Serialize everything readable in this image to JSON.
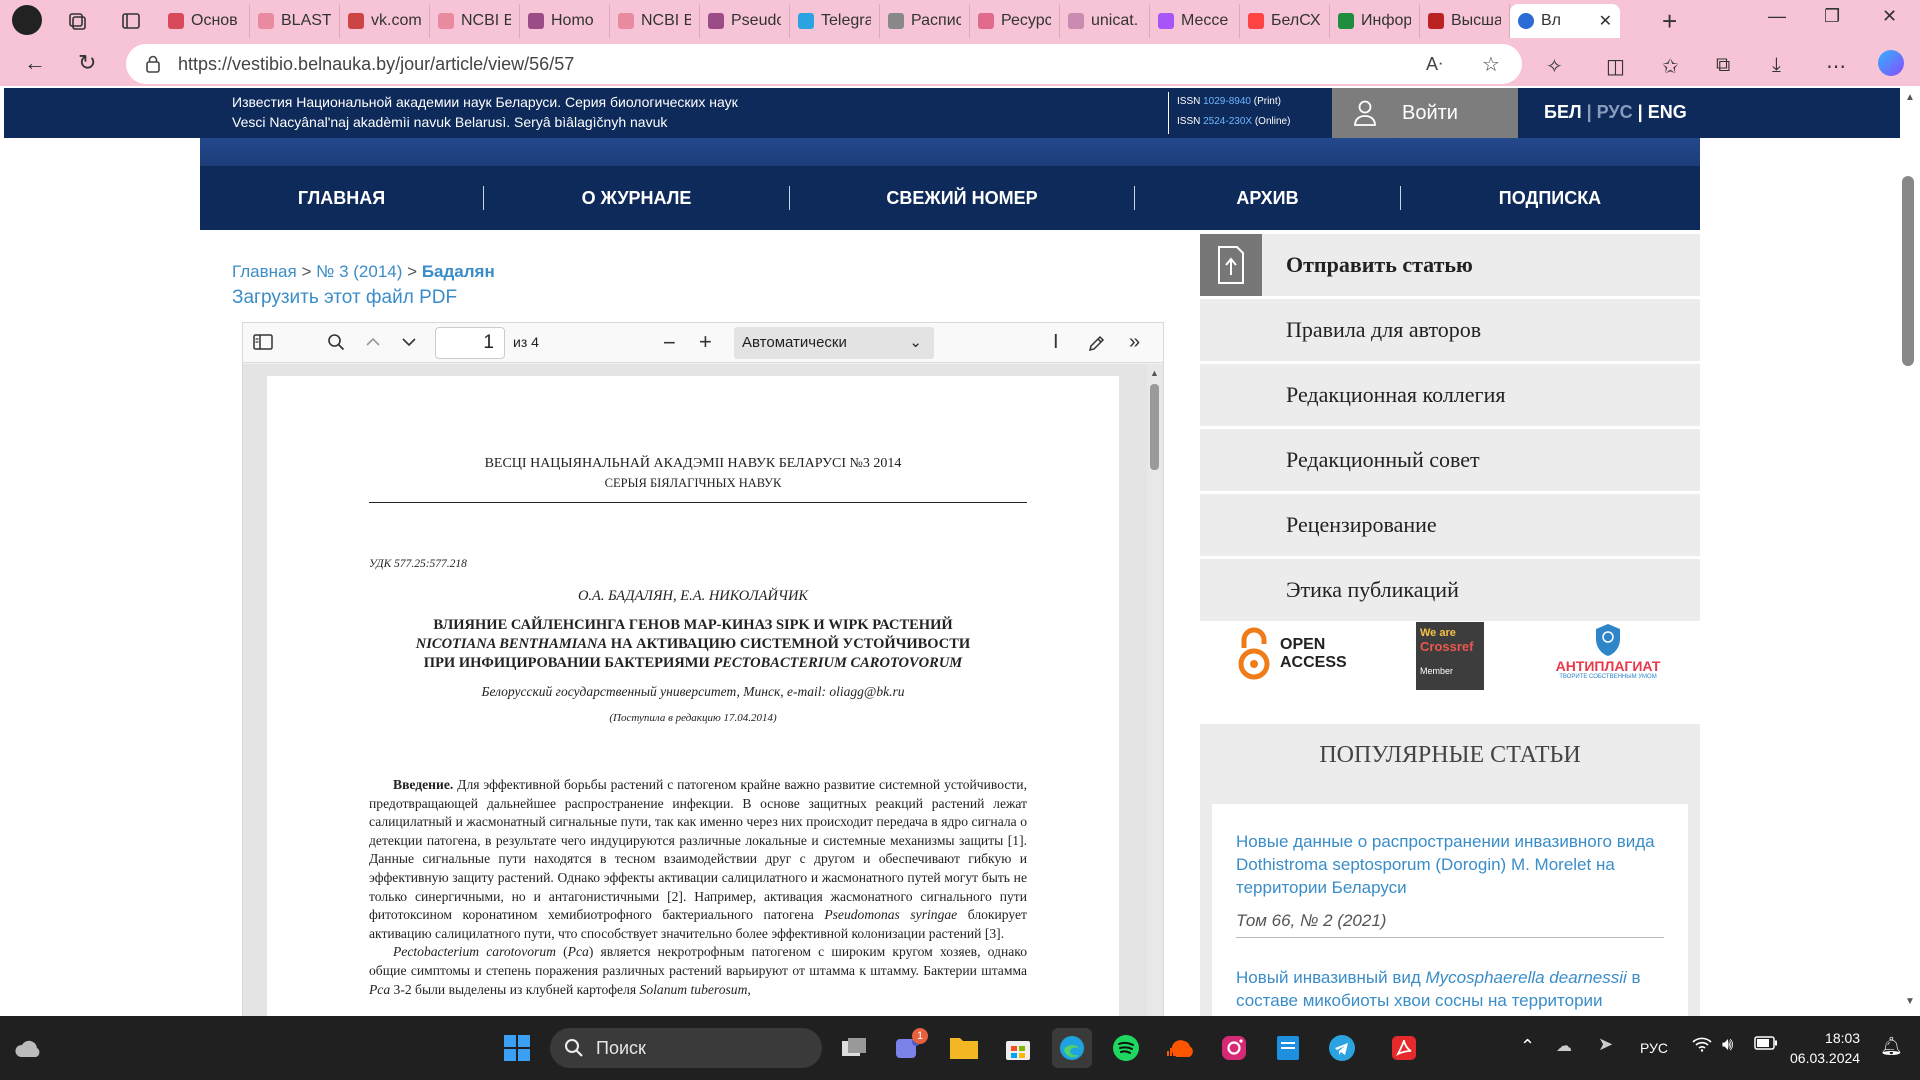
{
  "browser": {
    "tabs": [
      {
        "label": "Основ",
        "color": "#d94a5a"
      },
      {
        "label": "BLAST:",
        "color": "#e88aa0"
      },
      {
        "label": "vk.com",
        "color": "#c44"
      },
      {
        "label": "NCBI B",
        "color": "#e88aa0"
      },
      {
        "label": "Homo",
        "color": "#9b4b86"
      },
      {
        "label": "NCBI B",
        "color": "#e88aa0"
      },
      {
        "label": "Pseudo",
        "color": "#9b4b86"
      },
      {
        "label": "Telegra",
        "color": "#2aa3e0"
      },
      {
        "label": "Распис",
        "color": "#888"
      },
      {
        "label": "Ресурс",
        "color": "#e06b8b"
      },
      {
        "label": "unicat.",
        "color": "#c98bb0"
      },
      {
        "label": "Мессе",
        "color": "#a855f7"
      },
      {
        "label": "БелСХ",
        "color": "#f44"
      },
      {
        "label": "Инфор",
        "color": "#1e8e3e"
      },
      {
        "label": "Высша",
        "color": "#b22"
      }
    ],
    "active_tab": "Вл",
    "url": "https://vestibio.belnauka.by/jour/article/view/56/57"
  },
  "journal": {
    "title_ru": "Известия Национальной академии наук Беларуси. Серия биологических наук",
    "title_by": "Vesci Nacyânal'naj akadèmìi navuk Belarusì. Seryâ bìâlagìčnyh navuk",
    "issn_print_label": "ISSN",
    "issn_print": "1029-8940",
    "issn_print_note": "(Print)",
    "issn_online_label": "ISSN",
    "issn_online": "2524-230X",
    "issn_online_note": "(Online)",
    "login": "Войти",
    "lang_bel": "БЕЛ",
    "lang_rus": "РУС",
    "lang_eng": "ENG",
    "lang_sep": "|"
  },
  "nav": [
    "ГЛАВНАЯ",
    "О ЖУРНАЛЕ",
    "СВЕЖИЙ НОМЕР",
    "АРХИВ",
    "ПОДПИСКА"
  ],
  "breadcrumb": {
    "home": "Главная",
    "issue": "№ 3 (2014)",
    "current": "Бадалян",
    "sep": ">"
  },
  "download_pdf": "Загрузить этот файл PDF",
  "pdf_viewer": {
    "page": "1",
    "of": "из 4",
    "zoom": "Автоматически"
  },
  "pdf_page": {
    "header1": "ВЕСЦІ НАЦЫЯНАЛЬНАЙ АКАДЭМІІ НАВУК БЕЛАРУСІ №3 2014",
    "header2": "СЕРЫЯ БІЯЛАГІЧНЫХ НАВУК",
    "udk": "УДК 577.25:577.218",
    "authors": "О.А. БАДАЛЯН, Е.А. НИКОЛАЙЧИК",
    "title1": "ВЛИЯНИЕ САЙЛЕНСИНГА ГЕНОВ МАР-КИНАЗ SIPK И WIPK РАСТЕНИЙ",
    "title2a": "NICOTIANA BENTHAMIANA",
    "title2b": " НА АКТИВАЦИЮ СИСТЕМНОЙ УСТОЙЧИВОСТИ",
    "title3a": "ПРИ ИНФИЦИРОВАНИИ БАКТЕРИЯМИ ",
    "title3b": "PECTOBACTERIUM CAROTOVORUM",
    "affiliation": "Белорусский государственный университет, Минск, e-mail: oliagg@bk.ru",
    "received": "(Поступила в редакцию 17.04.2014)",
    "intro_label": "Введение.",
    "para1": " Для эффективной борьбы растений с патогеном крайне важно развитие системной устойчивости, предотвращающей дальнейшее распространение инфекции. В основе защитных реакций растений лежат салицилатный и жасмонатный сигнальные пути, так как именно через них происходит передача в ядро сигнала о детекции патогена, в результате чего индуцируются различные локальные и системные механизмы защиты [1]. Данные сигнальные пути находятся в тесном взаимодействии друг с другом и обеспечивают гибкую и эффективную защиту растений. Однако эффекты активации салицилатного и жасмонатного путей могут быть не только синергичными, но и антагонистичными [2]. Например, активация жасмонатного сигнального пути фитотоксином коронатином хемибиотрофного бактериального патогена ",
    "para1_italic": "Pseudomonas syringae",
    "para1_end": " блокирует активацию салицилатного пути, что способствует значительно более эффективной колонизации растений [3].",
    "para2_italic": "Pectobacterium carotovorum",
    "para2_a": " (",
    "para2_pca": "Pca",
    "para2_b": ") является некротрофным патогеном с широким кругом хозяев, однако общие симптомы и степень поражения различных растений варьируют от штамма к штамму. Бактерии штамма ",
    "para2_pca2": "Pca",
    "para2_c": " 3-2 были выделены из клубней картофеля ",
    "para2_sol": "Solanum tuberosum,"
  },
  "sidebar": {
    "items": [
      "Отправить статью",
      "Правила для авторов",
      "Редакционная коллегия",
      "Редакционный совет",
      "Рецензирование",
      "Этика публикаций"
    ],
    "open_access_1": "OPEN",
    "open_access_2": "ACCESS",
    "crossref_1": "We are",
    "crossref_2": "Crossref",
    "crossref_3": "Member",
    "antiplagiat": "АНТИПЛАГИАТ",
    "antiplagiat_sub": "ТВОРИТЕ СОБСТВЕННЫМ УМОМ",
    "popular_title": "ПОПУЛЯРНЫЕ СТАТЬИ",
    "popular": [
      {
        "title": "Новые данные о распространении инвазивного вида Dothistroma septosporum (Dorogin) M. Morelet на территории Беларуси",
        "meta": "Том 66, № 2 (2021)"
      },
      {
        "title_a": "Новый инвазивный вид ",
        "title_i": "Mycosphaerella dearnessii",
        "title_b": " в составе микобиоты хвои сосны на территории"
      }
    ]
  },
  "taskbar": {
    "search": "Поиск",
    "lang": "РУС",
    "time": "18:03",
    "date": "06.03.2024",
    "badge": "1"
  },
  "colors": {
    "navy": "#0d2a5a",
    "link": "#3a8dc8",
    "chrome": "#f6c4d6"
  }
}
